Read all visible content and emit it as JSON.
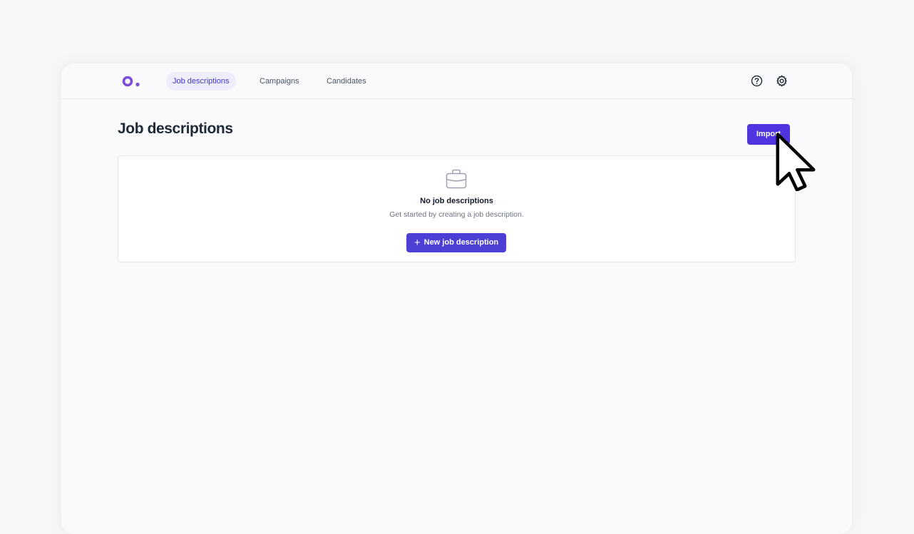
{
  "nav": {
    "items": [
      {
        "label": "Job descriptions",
        "active": true
      },
      {
        "label": "Campaigns",
        "active": false
      },
      {
        "label": "Candidates",
        "active": false
      }
    ],
    "icons": [
      "help-circle-icon",
      "gear-icon"
    ]
  },
  "page": {
    "title": "Job descriptions",
    "import_label": "Import"
  },
  "empty_state": {
    "icon": "briefcase-icon",
    "title": "No job descriptions",
    "subtitle": "Get started by creating a job description.",
    "button_label": "New job description"
  },
  "colors": {
    "accent": "#4f35e0",
    "logo": "#7c4ddb",
    "active_nav_bg": "#eeedfb",
    "active_nav_text": "#4338ca"
  }
}
